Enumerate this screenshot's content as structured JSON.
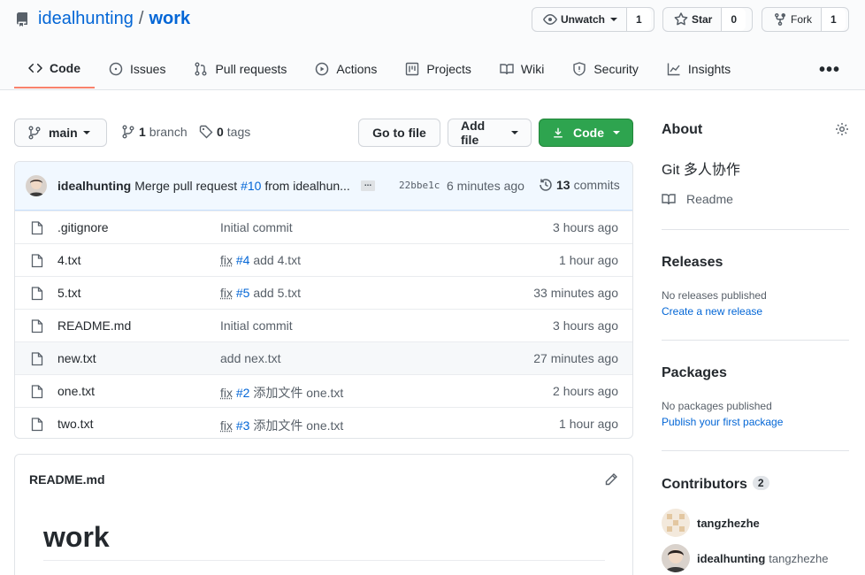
{
  "repo": {
    "owner": "idealhunting",
    "separator": "/",
    "name": "work"
  },
  "header_actions": {
    "unwatch": {
      "label": "Unwatch",
      "count": "1"
    },
    "star": {
      "label": "Star",
      "count": "0"
    },
    "fork": {
      "label": "Fork",
      "count": "1"
    }
  },
  "tabs": [
    {
      "label": "Code",
      "icon": "code-icon",
      "active": true
    },
    {
      "label": "Issues",
      "icon": "issue-icon"
    },
    {
      "label": "Pull requests",
      "icon": "pull-request-icon"
    },
    {
      "label": "Actions",
      "icon": "play-icon"
    },
    {
      "label": "Projects",
      "icon": "project-icon"
    },
    {
      "label": "Wiki",
      "icon": "book-icon"
    },
    {
      "label": "Security",
      "icon": "shield-icon"
    },
    {
      "label": "Insights",
      "icon": "graph-icon"
    }
  ],
  "more_label": "•••",
  "toolbar": {
    "branch": "main",
    "branch_count": "1",
    "branch_word": "branch",
    "tag_count": "0",
    "tag_word": "tags",
    "go_to_file": "Go to file",
    "add_file": "Add file",
    "code": "Code"
  },
  "latest_commit": {
    "author": "idealhunting",
    "message_prefix": "Merge pull request",
    "pr_link": "#10",
    "message_suffix": "from idealhun...",
    "ellipsis": "...",
    "sha": "22bbe1c",
    "time": "6 minutes ago",
    "commit_count": "13",
    "commit_word": "commits"
  },
  "files": [
    {
      "name": ".gitignore",
      "msg_plain": "Initial commit",
      "time": "3 hours ago"
    },
    {
      "name": "4.txt",
      "fix": "fix",
      "link": "#4",
      "msg_rest": "add 4.txt",
      "time": "1 hour ago"
    },
    {
      "name": "5.txt",
      "fix": "fix",
      "link": "#5",
      "msg_rest": "add 5.txt",
      "time": "33 minutes ago"
    },
    {
      "name": "README.md",
      "msg_plain": "Initial commit",
      "time": "3 hours ago"
    },
    {
      "name": "new.txt",
      "msg_plain": "add nex.txt",
      "time": "27 minutes ago"
    },
    {
      "name": "one.txt",
      "fix": "fix",
      "link": "#2",
      "msg_rest": "添加文件 one.txt",
      "time": "2 hours ago"
    },
    {
      "name": "two.txt",
      "fix": "fix",
      "link": "#3",
      "msg_rest": "添加文件 one.txt",
      "time": "1 hour ago"
    }
  ],
  "readme": {
    "filename": "README.md",
    "heading": "work"
  },
  "sidebar": {
    "about_title": "About",
    "description": "Git 多人协作",
    "readme_link": "Readme",
    "releases_title": "Releases",
    "releases_empty": "No releases published",
    "releases_link": "Create a new release",
    "packages_title": "Packages",
    "packages_empty": "No packages published",
    "packages_link": "Publish your first package",
    "contributors_title": "Contributors",
    "contributors_count": "2",
    "contributors": [
      {
        "login": "tangzhezhe",
        "name": ""
      },
      {
        "login": "idealhunting",
        "name": "tangzhezhe"
      }
    ]
  },
  "colors": {
    "link": "#0366d6",
    "green": "#2ea44f",
    "tab_underline": "#f9826c"
  }
}
